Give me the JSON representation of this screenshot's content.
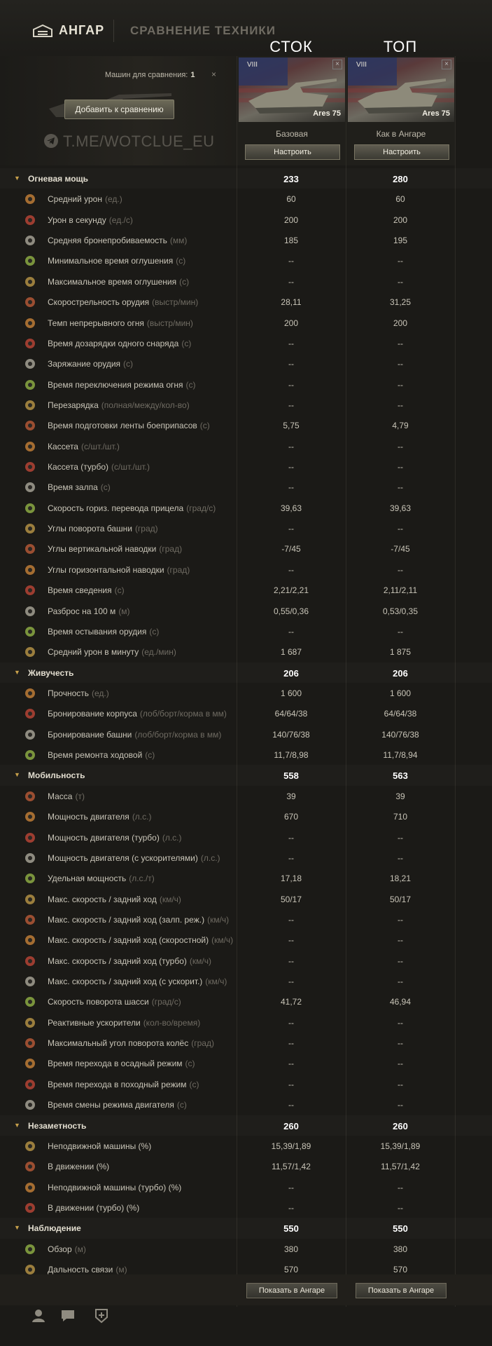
{
  "nav": {
    "hangar": "АНГАР",
    "compare": "СРАВНЕНИЕ ТЕХНИКИ"
  },
  "columns": {
    "left": "СТОК",
    "right": "ТОП"
  },
  "header": {
    "machines_label": "Машин для сравнения:",
    "machines_count": "1",
    "clear": "×",
    "add_button": "Добавить к сравнению",
    "watermark": "T.ME/WOTCLUE_EU"
  },
  "vehicles": [
    {
      "tier": "VIII",
      "name": "Ares 75",
      "config": "Базовая",
      "button": "Настроить",
      "close": "×"
    },
    {
      "tier": "VIII",
      "name": "Ares 75",
      "config": "Как в Ангаре",
      "button": "Настроить",
      "close": "×"
    }
  ],
  "rows": [
    {
      "type": "section",
      "label": "Огневая мощь",
      "unit": "",
      "v1": "233",
      "v2": "280"
    },
    {
      "type": "stat",
      "label": "Средний урон",
      "unit": "(ед.)",
      "v1": "60",
      "v2": "60"
    },
    {
      "type": "stat",
      "label": "Урон в секунду",
      "unit": "(ед./с)",
      "v1": "200",
      "v2": "200"
    },
    {
      "type": "stat",
      "label": "Средняя бронепробиваемость",
      "unit": "(мм)",
      "v1": "185",
      "v2": "195"
    },
    {
      "type": "stat",
      "label": "Минимальное время оглушения",
      "unit": "(с)",
      "v1": "--",
      "v2": "--"
    },
    {
      "type": "stat",
      "label": "Максимальное время оглушения",
      "unit": "(с)",
      "v1": "--",
      "v2": "--"
    },
    {
      "type": "stat",
      "label": "Скорострельность орудия",
      "unit": "(выстр/мин)",
      "v1": "28,11",
      "v2": "31,25"
    },
    {
      "type": "stat",
      "label": "Темп непрерывного огня",
      "unit": "(выстр/мин)",
      "v1": "200",
      "v2": "200"
    },
    {
      "type": "stat",
      "label": "Время дозарядки одного снаряда",
      "unit": "(с)",
      "v1": "--",
      "v2": "--"
    },
    {
      "type": "stat",
      "label": "Заряжание орудия",
      "unit": "(с)",
      "v1": "--",
      "v2": "--"
    },
    {
      "type": "stat",
      "label": "Время переключения режима огня",
      "unit": "(с)",
      "v1": "--",
      "v2": "--"
    },
    {
      "type": "stat",
      "label": "Перезарядка",
      "unit": "(полная/между/кол-во)",
      "v1": "--",
      "v2": "--"
    },
    {
      "type": "stat",
      "label": "Время подготовки ленты боеприпасов",
      "unit": "(с)",
      "v1": "5,75",
      "v2": "4,79"
    },
    {
      "type": "stat",
      "label": "Кассета",
      "unit": "(с/шт./шт.)",
      "v1": "--",
      "v2": "--"
    },
    {
      "type": "stat",
      "label": "Кассета (турбо)",
      "unit": "(с/шт./шт.)",
      "v1": "--",
      "v2": "--"
    },
    {
      "type": "stat",
      "label": "Время залпа",
      "unit": "(с)",
      "v1": "--",
      "v2": "--"
    },
    {
      "type": "stat",
      "label": "Скорость гориз. перевода прицела",
      "unit": "(град/с)",
      "v1": "39,63",
      "v2": "39,63"
    },
    {
      "type": "stat",
      "label": "Углы поворота башни",
      "unit": "(град)",
      "v1": "--",
      "v2": "--"
    },
    {
      "type": "stat",
      "label": "Углы вертикальной наводки",
      "unit": "(град)",
      "v1": "-7/45",
      "v2": "-7/45"
    },
    {
      "type": "stat",
      "label": "Углы горизонтальной наводки",
      "unit": "(град)",
      "v1": "--",
      "v2": "--"
    },
    {
      "type": "stat",
      "label": "Время сведения",
      "unit": "(с)",
      "v1": "2,21/2,21",
      "v2": "2,11/2,11"
    },
    {
      "type": "stat",
      "label": "Разброс на 100 м",
      "unit": "(м)",
      "v1": "0,55/0,36",
      "v2": "0,53/0,35"
    },
    {
      "type": "stat",
      "label": "Время остывания орудия",
      "unit": "(с)",
      "v1": "--",
      "v2": "--"
    },
    {
      "type": "stat",
      "label": "Средний урон в минуту",
      "unit": "(ед./мин)",
      "v1": "1 687",
      "v2": "1 875"
    },
    {
      "type": "section",
      "label": "Живучесть",
      "unit": "",
      "v1": "206",
      "v2": "206"
    },
    {
      "type": "stat",
      "label": "Прочность",
      "unit": "(ед.)",
      "v1": "1 600",
      "v2": "1 600"
    },
    {
      "type": "stat",
      "label": "Бронирование корпуса",
      "unit": "(лоб/борт/корма в мм)",
      "v1": "64/64/38",
      "v2": "64/64/38"
    },
    {
      "type": "stat",
      "label": "Бронирование башни",
      "unit": "(лоб/борт/корма в мм)",
      "v1": "140/76/38",
      "v2": "140/76/38"
    },
    {
      "type": "stat",
      "label": "Время ремонта ходовой",
      "unit": "(с)",
      "v1": "11,7/8,98",
      "v2": "11,7/8,94"
    },
    {
      "type": "section",
      "label": "Мобильность",
      "unit": "",
      "v1": "558",
      "v2": "563"
    },
    {
      "type": "stat",
      "label": "Масса",
      "unit": "(т)",
      "v1": "39",
      "v2": "39"
    },
    {
      "type": "stat",
      "label": "Мощность двигателя",
      "unit": "(л.с.)",
      "v1": "670",
      "v2": "710"
    },
    {
      "type": "stat",
      "label": "Мощность двигателя (турбо)",
      "unit": "(л.с.)",
      "v1": "--",
      "v2": "--"
    },
    {
      "type": "stat",
      "label": "Мощность двигателя (с ускорителями)",
      "unit": "(л.с.)",
      "v1": "--",
      "v2": "--"
    },
    {
      "type": "stat",
      "label": "Удельная мощность",
      "unit": "(л.с./т)",
      "v1": "17,18",
      "v2": "18,21"
    },
    {
      "type": "stat",
      "label": "Макс. скорость / задний ход",
      "unit": "(км/ч)",
      "v1": "50/17",
      "v2": "50/17"
    },
    {
      "type": "stat",
      "label": "Макс. скорость / задний ход (залп. реж.)",
      "unit": "(км/ч)",
      "v1": "--",
      "v2": "--"
    },
    {
      "type": "stat",
      "label": "Макс. скорость / задний ход (скоростной)",
      "unit": "(км/ч)",
      "v1": "--",
      "v2": "--"
    },
    {
      "type": "stat",
      "label": "Макс. скорость / задний ход (турбо)",
      "unit": "(км/ч)",
      "v1": "--",
      "v2": "--"
    },
    {
      "type": "stat",
      "label": "Макс. скорость / задний ход (с ускорит.)",
      "unit": "(км/ч)",
      "v1": "--",
      "v2": "--"
    },
    {
      "type": "stat",
      "label": "Скорость поворота шасси",
      "unit": "(град/с)",
      "v1": "41,72",
      "v2": "46,94"
    },
    {
      "type": "stat",
      "label": "Реактивные ускорители",
      "unit": "(кол-во/время)",
      "v1": "--",
      "v2": "--"
    },
    {
      "type": "stat",
      "label": "Максимальный угол поворота колёс",
      "unit": "(град)",
      "v1": "--",
      "v2": "--"
    },
    {
      "type": "stat",
      "label": "Время перехода в осадный режим",
      "unit": "(с)",
      "v1": "--",
      "v2": "--"
    },
    {
      "type": "stat",
      "label": "Время перехода в походный режим",
      "unit": "(с)",
      "v1": "--",
      "v2": "--"
    },
    {
      "type": "stat",
      "label": "Время смены режима двигателя",
      "unit": "(с)",
      "v1": "--",
      "v2": "--"
    },
    {
      "type": "section",
      "label": "Незаметность",
      "unit": "",
      "v1": "260",
      "v2": "260"
    },
    {
      "type": "stat",
      "label": "Неподвижной машины (%)",
      "unit": "",
      "v1": "15,39/1,89",
      "v2": "15,39/1,89"
    },
    {
      "type": "stat",
      "label": "В движении (%)",
      "unit": "",
      "v1": "11,57/1,42",
      "v2": "11,57/1,42"
    },
    {
      "type": "stat",
      "label": "Неподвижной машины (турбо) (%)",
      "unit": "",
      "v1": "--",
      "v2": "--"
    },
    {
      "type": "stat",
      "label": "В движении (турбо) (%)",
      "unit": "",
      "v1": "--",
      "v2": "--"
    },
    {
      "type": "section",
      "label": "Наблюдение",
      "unit": "",
      "v1": "550",
      "v2": "550"
    },
    {
      "type": "stat",
      "label": "Обзор",
      "unit": "(м)",
      "v1": "380",
      "v2": "380"
    },
    {
      "type": "stat",
      "label": "Дальность связи",
      "unit": "(м)",
      "v1": "570",
      "v2": "570"
    }
  ],
  "footer": {
    "show_button_1": "Показать в Ангаре",
    "show_button_2": "Показать в Ангаре"
  },
  "colors": {
    "accent": "#c7a04b",
    "background": "#1b1a17",
    "text": "#c9c5b8"
  }
}
